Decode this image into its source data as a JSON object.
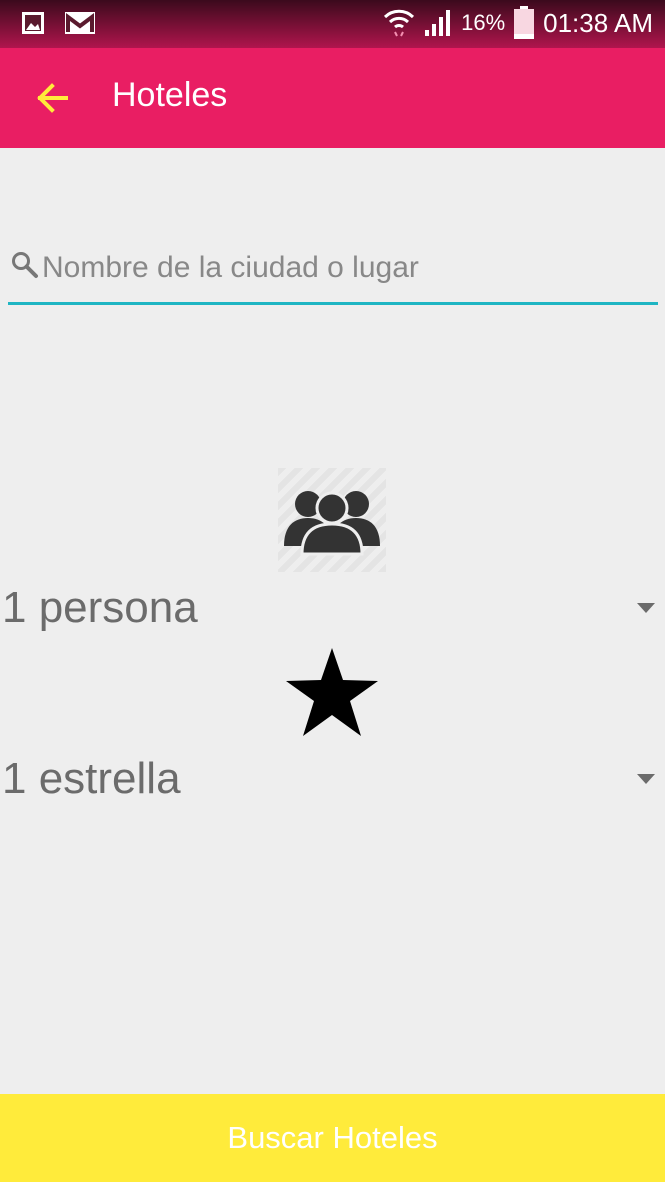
{
  "status_bar": {
    "battery_percent": "16%",
    "time": "01:38 AM",
    "icons": [
      "image-icon",
      "gmail-icon",
      "wifi-icon",
      "signal-icon",
      "battery-icon"
    ]
  },
  "app_bar": {
    "title": "Hoteles",
    "back_icon": "arrow-back-icon",
    "background_color": "#e91e63",
    "icon_color": "#ffeb3b"
  },
  "search": {
    "placeholder": "Nombre de la ciudad o lugar",
    "value": "",
    "underline_color": "#1fb5c3"
  },
  "guests": {
    "icon": "people-icon",
    "selected": "1 persona"
  },
  "rating": {
    "icon": "star-icon",
    "selected": "1 estrella"
  },
  "submit": {
    "label": "Buscar Hoteles",
    "background_color": "#ffeb3b"
  }
}
